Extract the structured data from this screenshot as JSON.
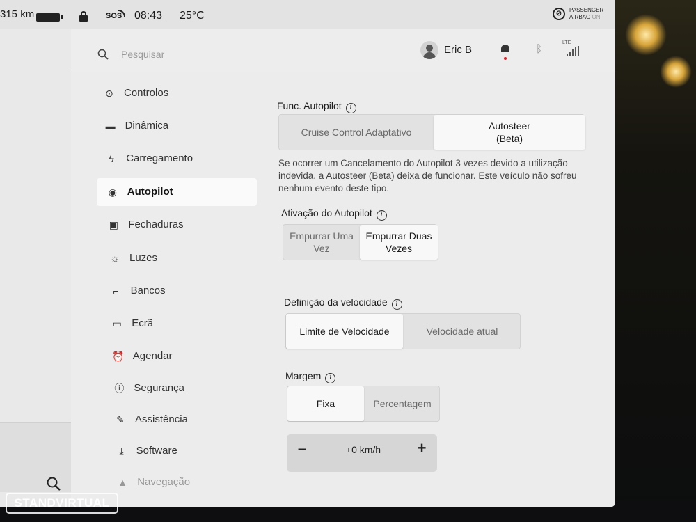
{
  "status": {
    "range": "315 km",
    "sos": "SOS",
    "time": "08:43",
    "temperature": "25°C",
    "airbag_line1": "PASSENGER",
    "airbag_line2": "AIRBAG",
    "airbag_state": "ON"
  },
  "header": {
    "search_placeholder": "Pesquisar",
    "user_name": "Eric B",
    "lte_label": "LTE"
  },
  "nav": {
    "items": [
      {
        "label": "Controlos",
        "icon": "toggle-icon"
      },
      {
        "label": "Dinâmica",
        "icon": "car-icon"
      },
      {
        "label": "Carregamento",
        "icon": "bolt-icon"
      },
      {
        "label": "Autopilot",
        "icon": "steering-wheel-icon",
        "active": true
      },
      {
        "label": "Fechaduras",
        "icon": "lock-icon"
      },
      {
        "label": "Luzes",
        "icon": "sun-icon"
      },
      {
        "label": "Bancos",
        "icon": "seat-icon"
      },
      {
        "label": "Ecrã",
        "icon": "display-icon"
      },
      {
        "label": "Agendar",
        "icon": "alarm-clock-icon"
      },
      {
        "label": "Segurança",
        "icon": "alert-circle-icon"
      },
      {
        "label": "Assistência",
        "icon": "wrench-icon"
      },
      {
        "label": "Software",
        "icon": "download-icon"
      },
      {
        "label": "Navegação",
        "icon": "navigation-icon"
      }
    ]
  },
  "autopilot": {
    "func_title": "Func. Autopilot",
    "func_options": [
      "Cruise Control Adaptativo",
      "Autosteer\n(Beta)"
    ],
    "func_selected": 1,
    "func_description": "Se ocorrer um Cancelamento do Autopilot 3 vezes devido a utilização indevida, a Autosteer (Beta) deixa de funcionar. Este veículo não sofreu nenhum evento deste tipo.",
    "activation_title": "Ativação do Autopilot",
    "activation_options": [
      "Empurrar Uma Vez",
      "Empurrar Duas Vezes"
    ],
    "activation_selected": 1,
    "speed_title": "Definição da velocidade",
    "speed_options": [
      "Limite de Velocidade",
      "Velocidade atual"
    ],
    "speed_selected": 0,
    "margin_title": "Margem",
    "margin_options": [
      "Fixa",
      "Percentagem"
    ],
    "margin_selected": 0,
    "offset_value": "+0 km/h",
    "minus_label": "−",
    "plus_label": "+"
  },
  "watermark": "STANDVIRTUAL"
}
